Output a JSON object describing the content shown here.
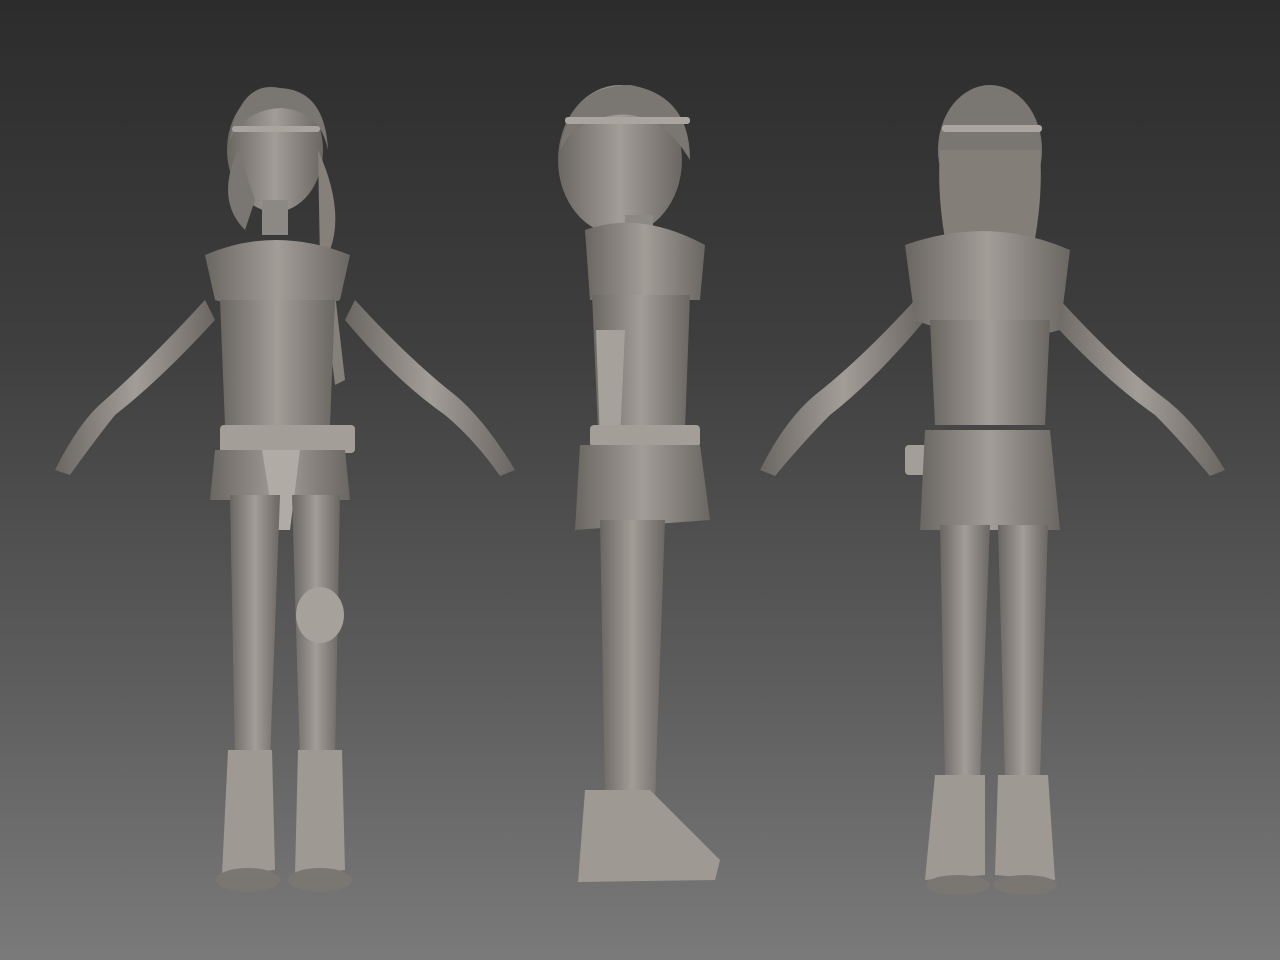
{
  "scene": {
    "views": [
      {
        "name": "front"
      },
      {
        "name": "side"
      },
      {
        "name": "back"
      }
    ],
    "colors": {
      "background_top": "#2c2c2c",
      "background_bottom": "#7a7a7a",
      "clay": "#8e8a85",
      "clay_light": "#a8a39d",
      "clay_dark": "#5f5b57"
    }
  }
}
